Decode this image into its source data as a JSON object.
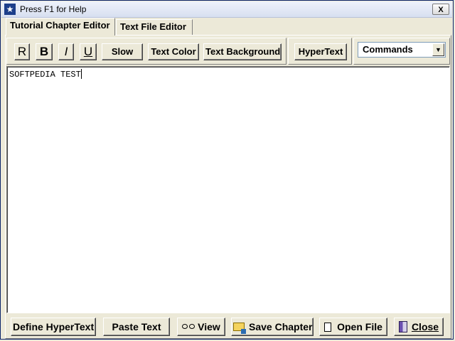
{
  "window": {
    "title": "Press F1 for Help",
    "app_icon": "star-app-icon",
    "close_label": "X"
  },
  "tabs": [
    {
      "label": "Tutorial Chapter Editor",
      "active": true
    },
    {
      "label": "Text File Editor",
      "active": false
    }
  ],
  "toolbar": {
    "regular_label": "R",
    "bold_label": "B",
    "italic_label": "I",
    "underline_label": "U",
    "slow_label": "Slow",
    "text_color_label": "Text Color",
    "text_background_label": "Text Background",
    "hypertext_label": "HyperText",
    "commands_select": {
      "value": "Commands"
    }
  },
  "editor": {
    "content": "SOFTPEDIA TEST"
  },
  "bottombar": {
    "define_hypertext_label": "Define HyperText",
    "paste_text_label": "Paste Text",
    "view_label": "View",
    "save_chapter_label": "Save Chapter",
    "open_file_label": "Open File",
    "close_label": "Close"
  },
  "icons": [
    "star-app-icon",
    "glasses-icon",
    "folder-save-icon",
    "document-icon",
    "door-exit-icon"
  ]
}
